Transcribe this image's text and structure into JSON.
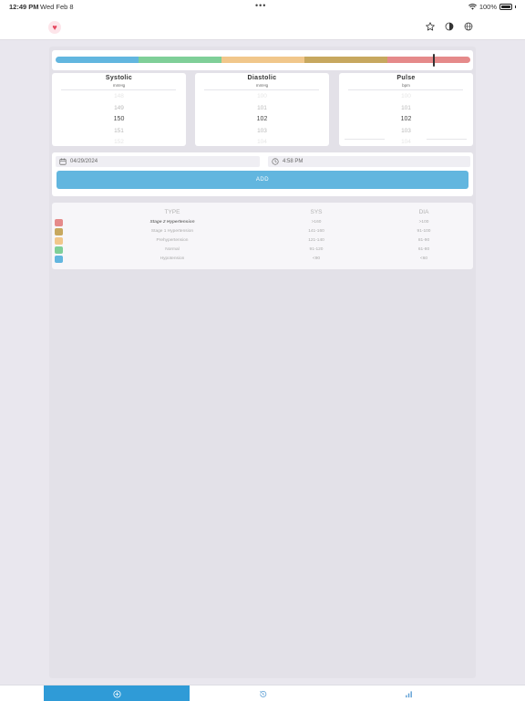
{
  "status": {
    "time": "12:49 PM",
    "date": "Wed Feb 8",
    "dots": "•••",
    "battery": "100%"
  },
  "nav": {
    "logo_icon": "heart-icon",
    "icons": [
      "star-icon",
      "contrast-icon",
      "globe-icon"
    ]
  },
  "gauge": {
    "segments": [
      {
        "name": "Hypotension",
        "color": "#62b6df",
        "fraction": 0.2
      },
      {
        "name": "Normal",
        "color": "#7fcf98",
        "fraction": 0.2
      },
      {
        "name": "Prehypertension",
        "color": "#f1c78b",
        "fraction": 0.2
      },
      {
        "name": "Stage 1 Hypertension",
        "color": "#c7a85f",
        "fraction": 0.2
      },
      {
        "name": "Stage 2 Hypertension",
        "color": "#e58a8a",
        "fraction": 0.2
      }
    ],
    "marker_fraction": 0.91
  },
  "pickers": [
    {
      "title": "Systolic",
      "unit": "mmHg",
      "values": [
        "148",
        "149",
        "150",
        "151",
        "152"
      ]
    },
    {
      "title": "Diastolic",
      "unit": "mmHg",
      "values": [
        "100",
        "101",
        "102",
        "103",
        "104"
      ]
    },
    {
      "title": "Pulse",
      "unit": "bpm",
      "values": [
        "100",
        "101",
        "102",
        "103",
        "104"
      ]
    }
  ],
  "datetime": {
    "date": "04/29/2024",
    "time": "4:58 PM",
    "add_label": "ADD"
  },
  "legend": {
    "headers": {
      "type": "TYPE",
      "sys": "SYS",
      "dia": "DIA"
    },
    "rows": [
      {
        "type": "Stage 2 Hypertension",
        "sys": ">160",
        "dia": ">100",
        "color": "#e58a8a",
        "active": true
      },
      {
        "type": "Stage 1 Hypertension",
        "sys": "141-160",
        "dia": "91-100",
        "color": "#c7a85f",
        "active": false
      },
      {
        "type": "Prehypertension",
        "sys": "121-140",
        "dia": "81-90",
        "color": "#f1c78b",
        "active": false
      },
      {
        "type": "Normal",
        "sys": "91-120",
        "dia": "61-80",
        "color": "#7fcf98",
        "active": false
      },
      {
        "type": "Hypotension",
        "sys": "<90",
        "dia": "<60",
        "color": "#62b6df",
        "active": false
      }
    ]
  },
  "tabs": [
    {
      "icon": "add-circle-icon",
      "active": true
    },
    {
      "icon": "history-icon",
      "active": false
    },
    {
      "icon": "chart-icon",
      "active": false
    }
  ]
}
